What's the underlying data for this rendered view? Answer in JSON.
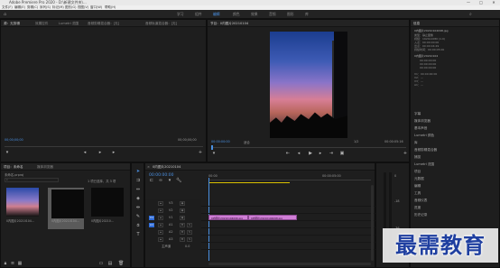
{
  "app": {
    "title": "Adobe Premiere Pro 2020 - D:\\新建文件夹\\...",
    "window_controls": [
      "—",
      "□",
      "✕"
    ]
  },
  "menu": [
    "文件(F)",
    "编辑(E)",
    "剪辑(C)",
    "序列(S)",
    "标记(M)",
    "图形(G)",
    "视图(V)",
    "窗口(W)",
    "帮助(H)"
  ],
  "workspaces": [
    "学习",
    "组件",
    "编辑",
    "颜色",
    "效果",
    "音频",
    "图形",
    "库"
  ],
  "source_panel": {
    "tabs": [
      "源：无剪辑",
      "效果控件",
      "Lumetri 范围",
      "音频剪辑混合器：[无]",
      "音频轨道混合器：[无]"
    ],
    "timecode_left": "00;00;00;00",
    "timecode_right": "00;00;00;00"
  },
  "program_panel": {
    "title": "节目：0内图片20210104",
    "timecode": "00:00:00:00",
    "fit": "适合",
    "scale": "1/2",
    "duration": "00:00:05:16"
  },
  "project_panel": {
    "tabs": [
      "项目：未命名",
      "媒体浏览器"
    ],
    "search_placeholder": "",
    "path": "未命名.prproj",
    "selection_count": "1 项已选择，共 3 项",
    "items": [
      {
        "name": "0内图片20210104...",
        "duration": "5:00"
      },
      {
        "name": "0内图片20210104...",
        "duration": "5:00"
      },
      {
        "name": "0内图片20210...",
        "duration": "5:00"
      }
    ]
  },
  "timeline": {
    "tab": "0内图片20210104",
    "timecode": "00:00:00:00",
    "ruler_start": "00:00",
    "ruler_mid": "00:00:05:00",
    "tracks": [
      "V3",
      "V2",
      "V1",
      "A1",
      "A2",
      "A3",
      "主声道"
    ],
    "master_value": "0.0",
    "clips": [
      {
        "name": "0内图片20210104096.jpg"
      },
      {
        "name": "0内图片20210104098.jpg"
      }
    ]
  },
  "info_panel": {
    "tabs": [
      "信息",
      "效果",
      "标记",
      "历史记录"
    ],
    "file": "0内图片20210104098.jpg",
    "meta": [
      "类型：静止图像",
      "视频：1920x1080 (1.0)",
      "入点：00:00:00:00",
      "出点：00:00:04:29",
      "持续时间：00:00:05:00"
    ],
    "seq_title": "0内图片20210104",
    "seq_meta": [
      "00:00:00:00",
      "00:00:00:00",
      "00:00:00:00"
    ],
    "track_meta": [
      "V1：00:00:00:00",
      "V2：—",
      "V3：—",
      "A1：—"
    ]
  },
  "right_list": [
    "字幕",
    "媒体浏览器",
    "基本声音",
    "Lumetri 颜色",
    "库",
    "音频剪辑混合器",
    "捕捉",
    "Lumetri 范围",
    "项目",
    "元数据",
    "编辑",
    "工具",
    "音频仪表",
    "进度",
    "历史记录",
    "捕捉",
    "时间码"
  ],
  "watermark": "最需教育"
}
